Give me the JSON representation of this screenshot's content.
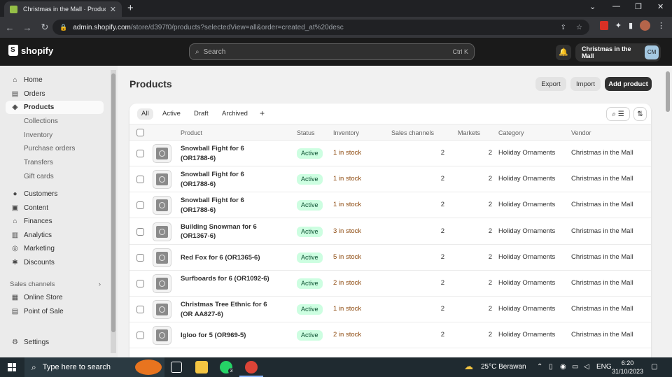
{
  "browser": {
    "tab_title": "Christmas in the Mall · Products",
    "url_host": "admin.shopify.com",
    "url_path": "/store/d397f0/products?selectedView=all&order=created_at%20desc"
  },
  "topbar": {
    "brand": "shopify",
    "search_placeholder": "Search",
    "search_shortcut": "Ctrl K",
    "store_name": "Christmas in the Mall",
    "store_initials": "CM"
  },
  "sidebar": {
    "items": [
      {
        "label": "Home",
        "icon": "home-icon"
      },
      {
        "label": "Orders",
        "icon": "orders-icon"
      },
      {
        "label": "Products",
        "icon": "tag-icon"
      },
      {
        "label": "Customers",
        "icon": "person-icon"
      },
      {
        "label": "Content",
        "icon": "content-icon"
      },
      {
        "label": "Finances",
        "icon": "bank-icon"
      },
      {
        "label": "Analytics",
        "icon": "chart-icon"
      },
      {
        "label": "Marketing",
        "icon": "target-icon"
      },
      {
        "label": "Discounts",
        "icon": "discount-icon"
      }
    ],
    "product_subitems": [
      "Collections",
      "Inventory",
      "Purchase orders",
      "Transfers",
      "Gift cards"
    ],
    "sales_channels_heading": "Sales channels",
    "channels": [
      {
        "label": "Online Store",
        "icon": "store-icon"
      },
      {
        "label": "Point of Sale",
        "icon": "pos-icon"
      }
    ],
    "settings": "Settings"
  },
  "page": {
    "title": "Products",
    "export": "Export",
    "import": "Import",
    "add_product": "Add product"
  },
  "views": [
    "All",
    "Active",
    "Draft",
    "Archived"
  ],
  "table": {
    "columns": [
      "Product",
      "Status",
      "Inventory",
      "Sales channels",
      "Markets",
      "Category",
      "Vendor"
    ],
    "rows": [
      {
        "name": "Snowball Fight for 6 (OR1788-6)",
        "status": "Active",
        "inventory": "1 in stock",
        "channels": "2",
        "markets": "2",
        "category": "Holiday Ornaments",
        "vendor": "Christmas in the Mall"
      },
      {
        "name": "Snowball Fight for 6 (OR1788-6)",
        "status": "Active",
        "inventory": "1 in stock",
        "channels": "2",
        "markets": "2",
        "category": "Holiday Ornaments",
        "vendor": "Christmas in the Mall"
      },
      {
        "name": "Snowball Fight for 6 (OR1788-6)",
        "status": "Active",
        "inventory": "1 in stock",
        "channels": "2",
        "markets": "2",
        "category": "Holiday Ornaments",
        "vendor": "Christmas in the Mall"
      },
      {
        "name": "Building Snowman for 6 (OR1367-6)",
        "status": "Active",
        "inventory": "3 in stock",
        "channels": "2",
        "markets": "2",
        "category": "Holiday Ornaments",
        "vendor": "Christmas in the Mall"
      },
      {
        "name": "Red Fox for 6 (OR1365-6)",
        "status": "Active",
        "inventory": "5 in stock",
        "channels": "2",
        "markets": "2",
        "category": "Holiday Ornaments",
        "vendor": "Christmas in the Mall"
      },
      {
        "name": "Surfboards for 6 (OR1092-6)",
        "status": "Active",
        "inventory": "2 in stock",
        "channels": "2",
        "markets": "2",
        "category": "Holiday Ornaments",
        "vendor": "Christmas in the Mall"
      },
      {
        "name": "Christmas Tree Ethnic for 6 (OR AA827-6)",
        "status": "Active",
        "inventory": "1 in stock",
        "channels": "2",
        "markets": "2",
        "category": "Holiday Ornaments",
        "vendor": "Christmas in the Mall"
      },
      {
        "name": "Igloo for 5 (OR969-5)",
        "status": "Active",
        "inventory": "2 in stock",
        "channels": "2",
        "markets": "2",
        "category": "Holiday Ornaments",
        "vendor": "Christmas in the Mall"
      }
    ]
  },
  "taskbar": {
    "search_placeholder": "Type here to search",
    "whatsapp_badge": "3",
    "weather": "25°C Berawan",
    "lang": "ENG",
    "time": "6:20",
    "date": "31/10/2023"
  },
  "colors": {
    "topbar_bg": "#1a1a1a",
    "active_badge_bg": "#cdfee1",
    "active_badge_text": "#0c5132",
    "stock_text": "#8e4b10",
    "primary_button": "#303030"
  }
}
